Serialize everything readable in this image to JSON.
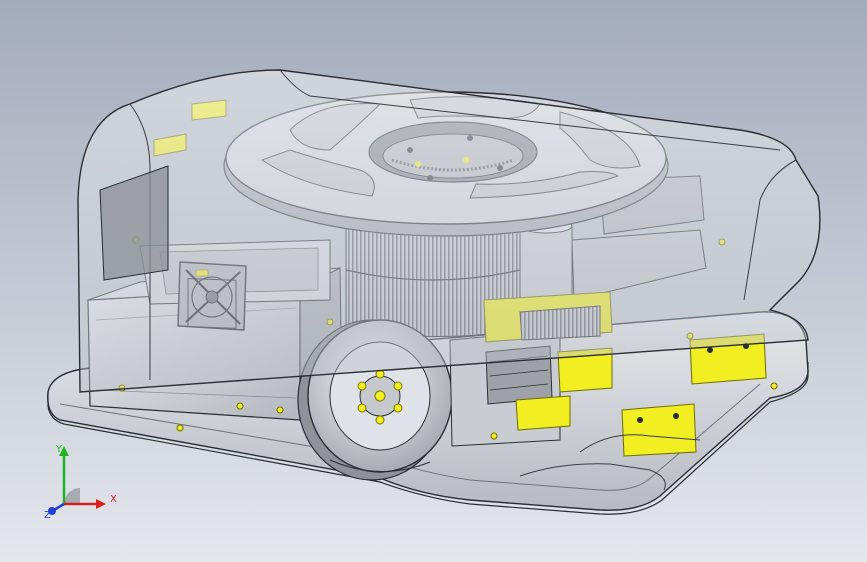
{
  "viewport": {
    "background_top": "#a3acbd",
    "background_bottom": "#e4e7ec"
  },
  "model": {
    "shell_color": "#d9dce1",
    "steel_color": "#c9ccd1",
    "dark_steel": "#6f7378",
    "accent_color": "#f1ee22",
    "accent_dark": "#b9b50f",
    "edge_color": "#2a2d31"
  },
  "triad": {
    "x_label": "X",
    "y_label": "Y",
    "z_label": "Z",
    "x_color": "#d61f1f",
    "y_color": "#22b322",
    "z_color": "#1f3fd6"
  }
}
